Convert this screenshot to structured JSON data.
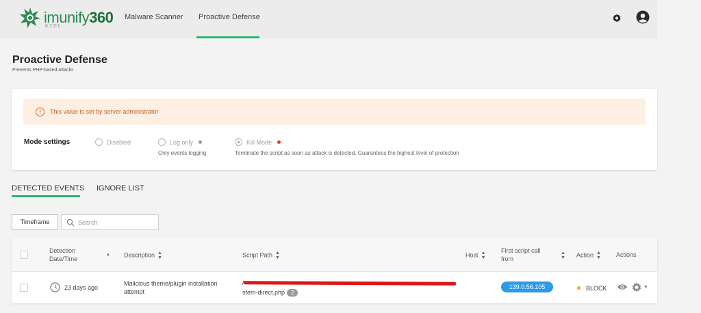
{
  "app": {
    "logo_text": "imunify",
    "logo_number": "360",
    "version": "6.7.3-1"
  },
  "nav": {
    "items": [
      {
        "label": "Malware Scanner"
      },
      {
        "label": "Proactive Defense",
        "active": true
      }
    ]
  },
  "page": {
    "title": "Proactive Defense",
    "subtitle": "Prevents PHP-based attacks"
  },
  "alert": {
    "text": "This value is set by server administrator",
    "icon": "info-circle-icon"
  },
  "mode_settings": {
    "label": "Mode settings",
    "options": [
      {
        "label": "Disabled",
        "description": "",
        "selected": false
      },
      {
        "label": "Log only",
        "description": "Only events logging",
        "selected": false,
        "dot_color": "#9a9a9a"
      },
      {
        "label": "Kill Mode",
        "description": "Terminate the script as soon as attack is detected. Guarantees the highest level of protection",
        "selected": true,
        "dot_color": "#e53935"
      }
    ]
  },
  "tabs": [
    {
      "label": "DETECTED EVENTS",
      "active": true
    },
    {
      "label": "IGNORE LIST",
      "active": false
    }
  ],
  "filters": {
    "timeframe_label": "Timeframe",
    "search_placeholder": "Search"
  },
  "table": {
    "headers": {
      "date": "Detection Date/Time",
      "description": "Description",
      "script_path": "Script Path",
      "host": "Host",
      "first_call": "First script call from",
      "action": "Action",
      "actions": "Actions"
    },
    "rows": [
      {
        "time": "23 days ago",
        "description": "Malicious theme/plugin installation attempt",
        "script_path_prefix": "/",
        "script_path_end": "stem-direct.php",
        "count": "2",
        "host": "",
        "ip": "139.0.56.105",
        "action": "BLOCK"
      }
    ]
  },
  "colors": {
    "accent_green": "#2bb673",
    "alert_bg": "#fdf0e2",
    "alert_text": "#c2622a",
    "ip_pill": "#2b9ae8",
    "block_dot": "#f5a623"
  }
}
